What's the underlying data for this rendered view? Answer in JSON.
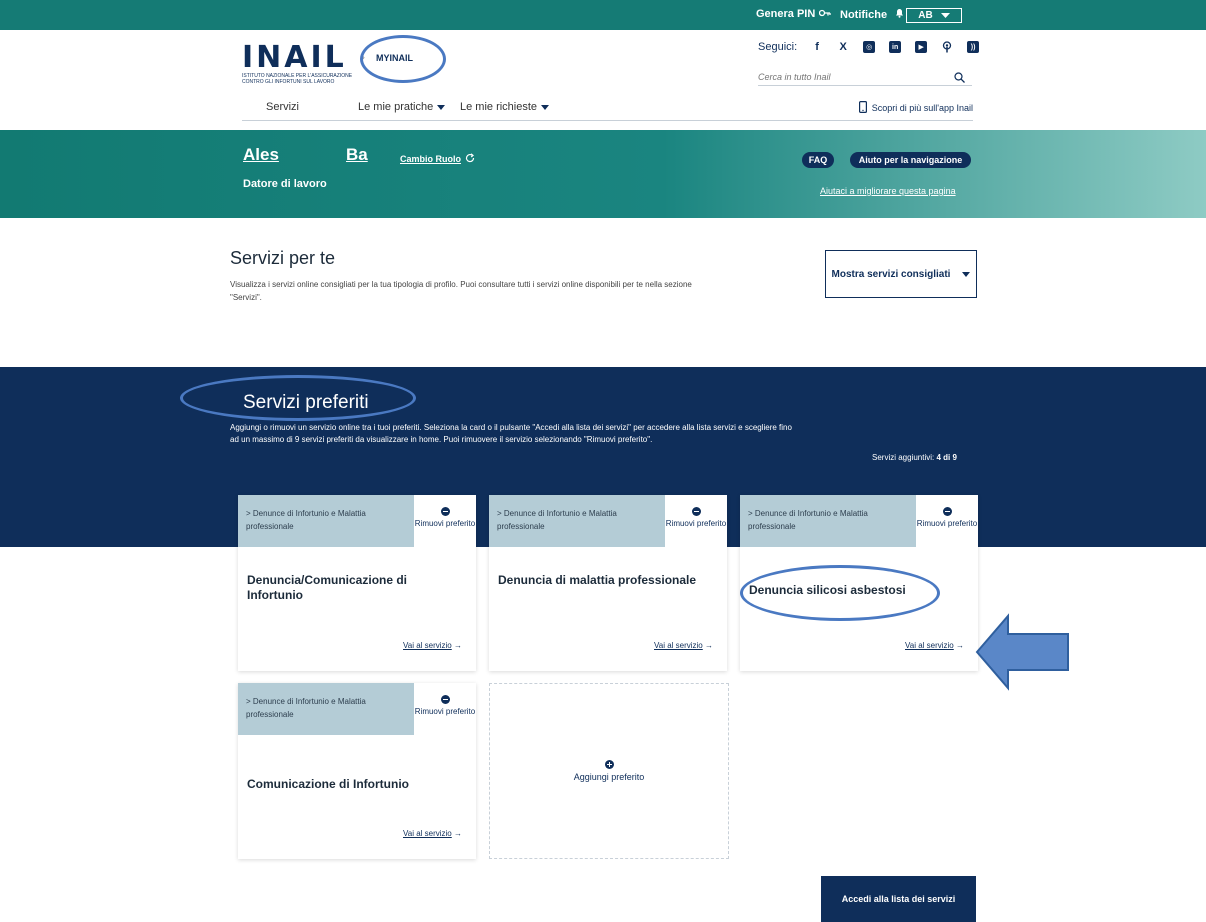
{
  "topbar": {
    "genera_pin": "Genera PIN",
    "notifiche": "Notifiche",
    "lang": "AB"
  },
  "header": {
    "logo": "INAIL",
    "logo_sub": "ISTITUTO NAZIONALE PER L'ASSICURAZIONE CONTRO GLI INFORTUNI SUL LAVORO",
    "portal": "MYINAIL",
    "seguici": "Seguici:",
    "search_placeholder": "Cerca in tutto Inail",
    "nav": [
      "Servizi",
      "Le mie pratiche",
      "Le mie richieste"
    ],
    "app_link": "Scopri di più sull'app Inail"
  },
  "hero": {
    "first_name": "Ales",
    "last_name": "Ba",
    "cambio_ruolo": "Cambio Ruolo",
    "role": "Datore di lavoro",
    "faq": "FAQ",
    "aiuto": "Aiuto per la navigazione",
    "improve": "Aiutaci a migliorare questa pagina"
  },
  "servizi_per_te": {
    "title": "Servizi per te",
    "description": "Visualizza i servizi online consigliati per la tua tipologia di profilo. Puoi consultare tutti i servizi online disponibili per te nella sezione \"Servizi\".",
    "button": "Mostra servizi consigliati"
  },
  "servizi_preferiti": {
    "title": "Servizi preferiti",
    "description": "Aggiungi o rimuovi un servizio online tra i tuoi preferiti. Seleziona la card o il pulsante \"Accedi alla lista dei servizi\" per accedere alla lista servizi e scegliere fino ad un massimo di 9 servizi preferiti da visualizzare in home. Puoi rimuovere il servizio selezionando \"Rimuovi preferito\".",
    "count_label": "Servizi aggiuntivi:",
    "count_value": "4 di 9",
    "cards": [
      {
        "category": "> Denunce di Infortunio e Malattia professionale",
        "remove": "Rimuovi preferito",
        "title": "Denuncia/Comunicazione di Infortunio",
        "link": "Vai al servizio"
      },
      {
        "category": "> Denunce di Infortunio e Malattia professionale",
        "remove": "Rimuovi preferito",
        "title": "Denuncia di malattia professionale",
        "link": "Vai al servizio"
      },
      {
        "category": "> Denunce di Infortunio e Malattia professionale",
        "remove": "Rimuovi preferito",
        "title": "Denuncia silicosi asbestosi",
        "link": "Vai al servizio"
      },
      {
        "category": "> Denunce di Infortunio e Malattia professionale",
        "remove": "Rimuovi preferito",
        "title": "Comunicazione di Infortunio",
        "link": "Vai al servizio"
      }
    ],
    "add_label": "Aggiungi preferito",
    "accedi_button": "Accedi alla lista dei servizi"
  },
  "colors": {
    "topbar": "#157b75",
    "navy": "#0f2e5a",
    "card_head": "#b4ccd6",
    "annotation": "#4a79c2"
  }
}
